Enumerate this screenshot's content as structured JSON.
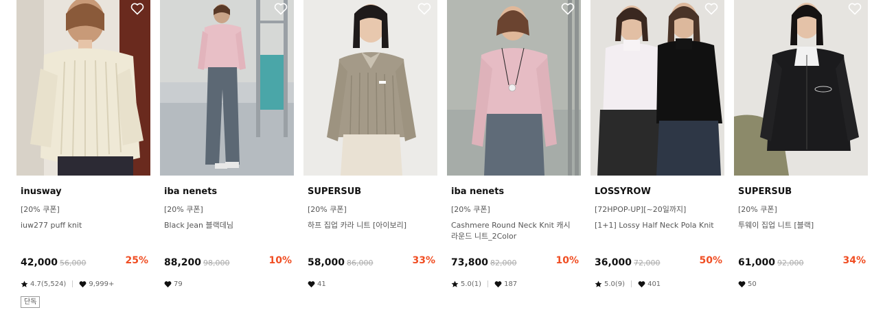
{
  "products": [
    {
      "brand": "inusway",
      "coupon": "[20% 쿠폰]",
      "name": "iuw277 puff knit",
      "price": "42,000",
      "original_price": "56,000",
      "discount": "25%",
      "rating": "4.7(5,524)",
      "likes": "9,999+",
      "tag": "단독"
    },
    {
      "brand": "iba nenets",
      "coupon": "[20% 쿠폰]",
      "name": "Black Jean 블랙데님",
      "price": "88,200",
      "original_price": "98,000",
      "discount": "10%",
      "likes": "79"
    },
    {
      "brand": "SUPERSUB",
      "coupon": "[20% 쿠폰]",
      "name": "하프 집업 카라 니트 [아이보리]",
      "price": "58,000",
      "original_price": "86,000",
      "discount": "33%",
      "likes": "41"
    },
    {
      "brand": "iba nenets",
      "coupon": "[20% 쿠폰]",
      "name": "Cashmere Round Neck Knit 캐시 라운드 니트_2Color",
      "price": "73,800",
      "original_price": "82,000",
      "discount": "10%",
      "rating": "5.0(1)",
      "likes": "187"
    },
    {
      "brand": "LOSSYROW",
      "coupon": "[72HPOP-UP][~20일까지]",
      "name": "[1+1] Lossy Half Neck Pola Knit",
      "price": "36,000",
      "original_price": "72,000",
      "discount": "50%",
      "rating": "5.0(9)",
      "likes": "401"
    },
    {
      "brand": "SUPERSUB",
      "coupon": "[20% 쿠폰]",
      "name": "투웨이 집업 니트 [블랙]",
      "price": "61,000",
      "original_price": "92,000",
      "discount": "34%",
      "likes": "50"
    }
  ],
  "colors": {
    "discount": "#f04e23",
    "text": "#111111",
    "muted": "#555555",
    "strike": "#aaaaaa"
  },
  "icons": {
    "wishlist": "heart-outline-icon",
    "rating": "star-icon",
    "likes": "heart-icon"
  }
}
